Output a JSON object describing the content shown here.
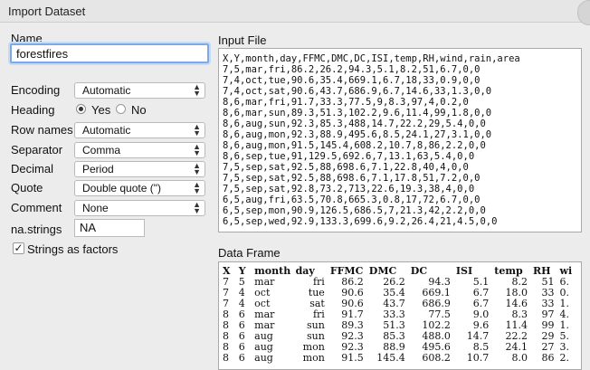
{
  "window": {
    "title": "Import Dataset"
  },
  "name": {
    "label": "Name",
    "value": "forestfires"
  },
  "encoding": {
    "label": "Encoding",
    "value": "Automatic"
  },
  "heading": {
    "label": "Heading",
    "yes": "Yes",
    "no": "No",
    "selected": "Yes"
  },
  "row_names": {
    "label": "Row names",
    "value": "Automatic"
  },
  "separator": {
    "label": "Separator",
    "value": "Comma"
  },
  "decimal": {
    "label": "Decimal",
    "value": "Period"
  },
  "quote": {
    "label": "Quote",
    "value": "Double quote (\")"
  },
  "comment": {
    "label": "Comment",
    "value": "None"
  },
  "na_strings": {
    "label": "na.strings",
    "value": "NA"
  },
  "strings_as_factors": {
    "label": "Strings as factors",
    "checked": true,
    "check_glyph": "✓"
  },
  "input_file": {
    "label": "Input File",
    "lines": [
      "X,Y,month,day,FFMC,DMC,DC,ISI,temp,RH,wind,rain,area",
      "7,5,mar,fri,86.2,26.2,94.3,5.1,8.2,51,6.7,0,0",
      "7,4,oct,tue,90.6,35.4,669.1,6.7,18,33,0.9,0,0",
      "7,4,oct,sat,90.6,43.7,686.9,6.7,14.6,33,1.3,0,0",
      "8,6,mar,fri,91.7,33.3,77.5,9,8.3,97,4,0.2,0",
      "8,6,mar,sun,89.3,51.3,102.2,9.6,11.4,99,1.8,0,0",
      "8,6,aug,sun,92.3,85.3,488,14.7,22.2,29,5.4,0,0",
      "8,6,aug,mon,92.3,88.9,495.6,8.5,24.1,27,3.1,0,0",
      "8,6,aug,mon,91.5,145.4,608.2,10.7,8,86,2.2,0,0",
      "8,6,sep,tue,91,129.5,692.6,7,13.1,63,5.4,0,0",
      "7,5,sep,sat,92.5,88,698.6,7.1,22.8,40,4,0,0",
      "7,5,sep,sat,92.5,88,698.6,7.1,17.8,51,7.2,0,0",
      "7,5,sep,sat,92.8,73.2,713,22.6,19.3,38,4,0,0",
      "6,5,aug,fri,63.5,70.8,665.3,0.8,17,72,6.7,0,0",
      "6,5,sep,mon,90.9,126.5,686.5,7,21.3,42,2.2,0,0",
      "6,5,sep,wed,92.9,133.3,699.6,9.2,26.4,21,4.5,0,0"
    ]
  },
  "data_frame": {
    "label": "Data Frame",
    "columns": [
      "X",
      "Y",
      "month",
      "day",
      "FFMC",
      "DMC",
      "DC",
      "ISI",
      "temp",
      "RH",
      "wi"
    ],
    "rows": [
      [
        "7",
        "5",
        "mar",
        "fri",
        "86.2",
        "26.2",
        "94.3",
        "5.1",
        "8.2",
        "51",
        "6."
      ],
      [
        "7",
        "4",
        "oct",
        "tue",
        "90.6",
        "35.4",
        "669.1",
        "6.7",
        "18.0",
        "33",
        "0."
      ],
      [
        "7",
        "4",
        "oct",
        "sat",
        "90.6",
        "43.7",
        "686.9",
        "6.7",
        "14.6",
        "33",
        "1."
      ],
      [
        "8",
        "6",
        "mar",
        "fri",
        "91.7",
        "33.3",
        "77.5",
        "9.0",
        "8.3",
        "97",
        "4."
      ],
      [
        "8",
        "6",
        "mar",
        "sun",
        "89.3",
        "51.3",
        "102.2",
        "9.6",
        "11.4",
        "99",
        "1."
      ],
      [
        "8",
        "6",
        "aug",
        "sun",
        "92.3",
        "85.3",
        "488.0",
        "14.7",
        "22.2",
        "29",
        "5."
      ],
      [
        "8",
        "6",
        "aug",
        "mon",
        "92.3",
        "88.9",
        "495.6",
        "8.5",
        "24.1",
        "27",
        "3."
      ],
      [
        "8",
        "6",
        "aug",
        "mon",
        "91.5",
        "145.4",
        "608.2",
        "10.7",
        "8.0",
        "86",
        "2."
      ]
    ]
  }
}
